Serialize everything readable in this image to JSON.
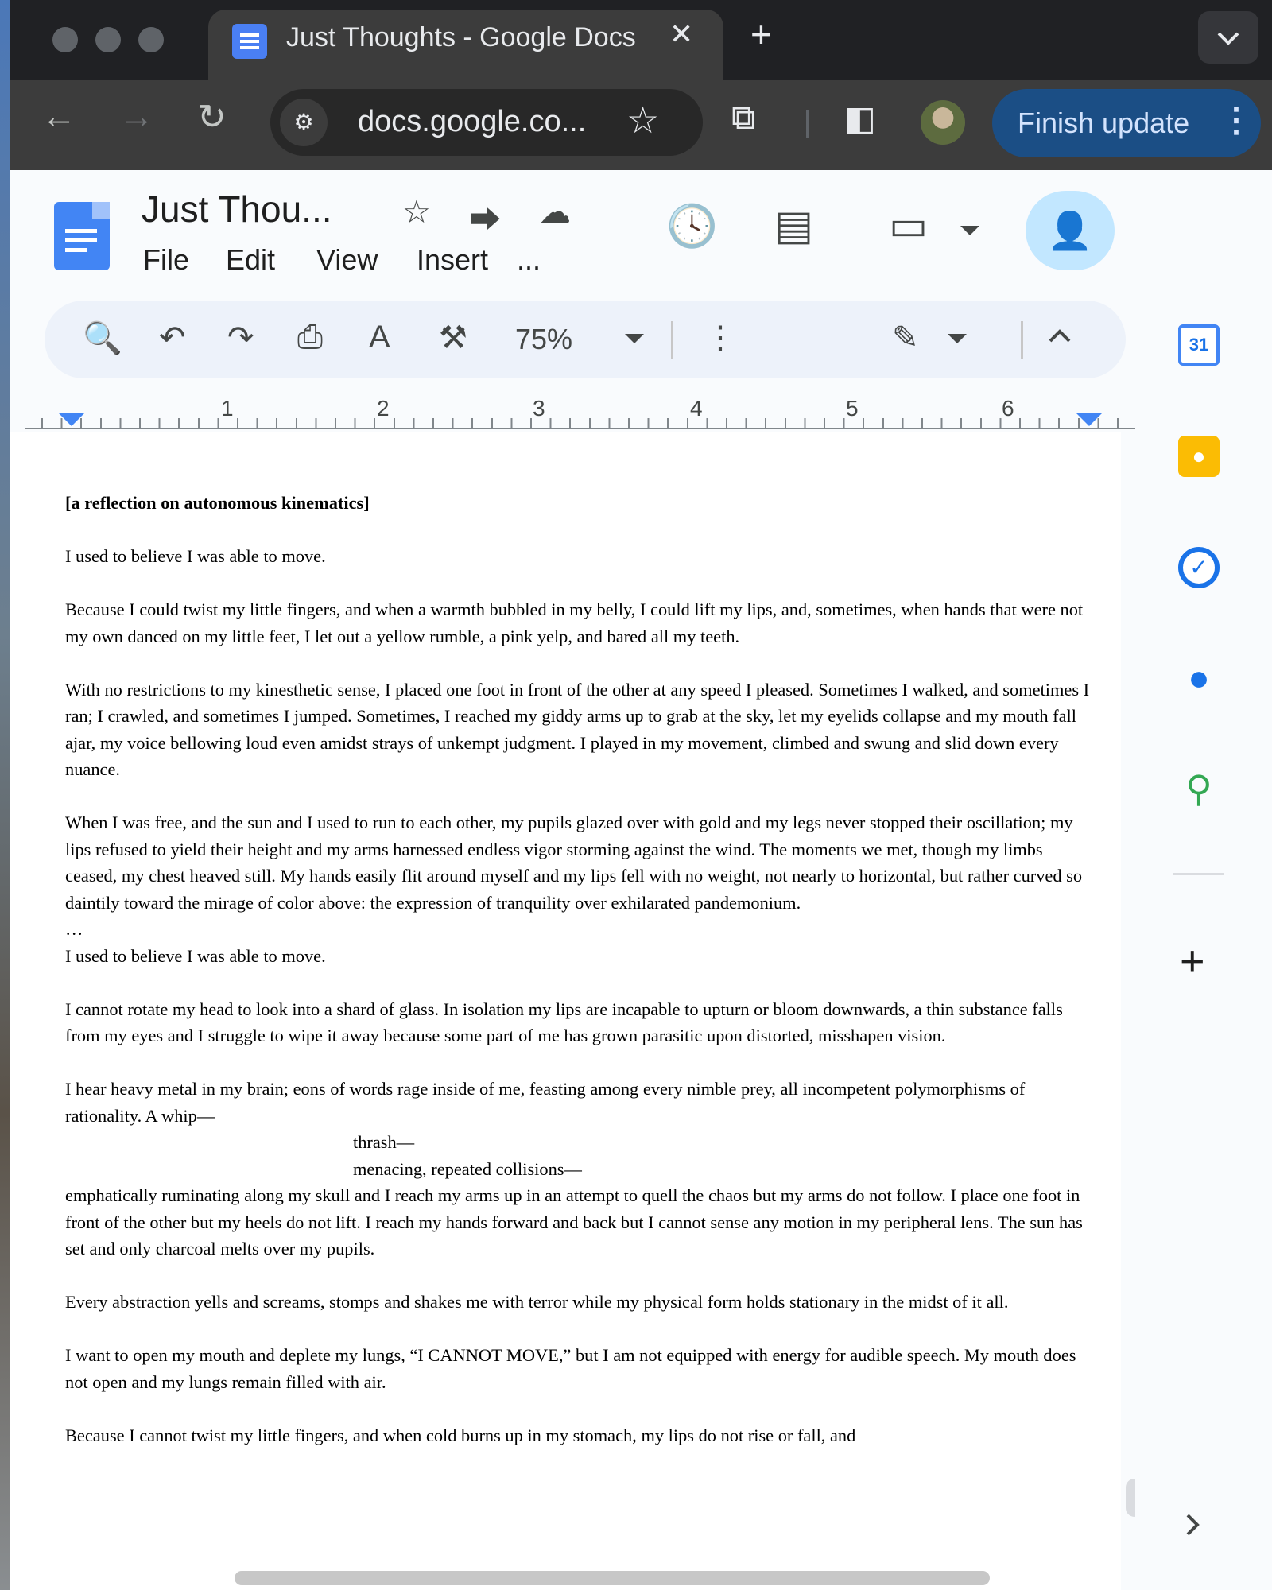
{
  "browser": {
    "tab_title": "Just Thoughts - Google Docs",
    "tab_close": "✕",
    "new_tab": "+",
    "url": "docs.google.co...",
    "finish_update": "Finish update"
  },
  "docs": {
    "title": "Just Thou...",
    "menus": [
      "File",
      "Edit",
      "View",
      "Insert",
      "..."
    ],
    "zoom": "75%",
    "ruler_numbers": [
      "1",
      "2",
      "3",
      "4",
      "5",
      "6"
    ]
  },
  "side_panel": {
    "calendar_day": "31"
  },
  "document": {
    "heading": "[a reflection on autonomous kinematics]",
    "paragraphs": [
      "I used to believe I was able to move.",
      "Because I could twist my little fingers, and when a warmth bubbled in my belly, I could lift my lips, and, sometimes, when hands that were not my own danced on my little feet, I let out a yellow rumble, a pink yelp, and bared all my teeth.",
      "With no restrictions to my kinesthetic sense, I placed one foot in front of the other at any speed I pleased. Sometimes I walked, and sometimes I ran; I crawled, and sometimes I jumped. Sometimes, I reached my giddy arms up to grab at the sky, let my eyelids collapse and my mouth fall ajar, my voice bellowing loud even amidst strays of unkempt judgment. I played in my movement, climbed and swung and slid down every nuance.",
      "When I was free, and the sun and I used to run to each other, my pupils glazed over with gold and my legs never stopped their oscillation; my lips refused to yield their height and my arms harnessed endless vigor storming against the wind. The moments we met, though my limbs ceased, my chest heaved still. My hands easily flit around myself and my lips fell with no weight, not nearly to horizontal, but rather curved so daintily toward the mirage of color above: the expression of tranquility over exhilarated pandemonium.",
      "…",
      "I used to believe I was able to move.",
      "I cannot rotate my head to look into a shard of glass. In isolation my lips are incapable to upturn or bloom downwards, a thin substance falls from my eyes and I struggle to wipe it away because some part of me has grown parasitic upon distorted, misshapen vision.",
      "I hear heavy metal in my brain; eons of words rage inside of me, feasting among every nimble prey, all incompetent polymorphisms of rationality. A whip—",
      "thrash—",
      "menacing, repeated collisions—",
      "emphatically ruminating along my skull and I reach my arms up in an attempt to quell the chaos but my arms do not follow. I place one foot in front of the other but my heels do not lift. I reach my hands forward and back but I cannot sense any motion in my peripheral lens. The sun has set and only charcoal melts over my pupils.",
      "Every abstraction yells and screams, stomps and shakes me with terror while my physical form holds stationary in the midst of it all.",
      "I want to open my mouth and deplete my lungs, “I CANNOT MOVE,” but I am not equipped with energy for audible speech. My mouth does not open and my lungs remain filled with air.",
      "Because I cannot twist my little fingers, and when cold burns up in my stomach, my lips do not rise or fall, and"
    ]
  }
}
